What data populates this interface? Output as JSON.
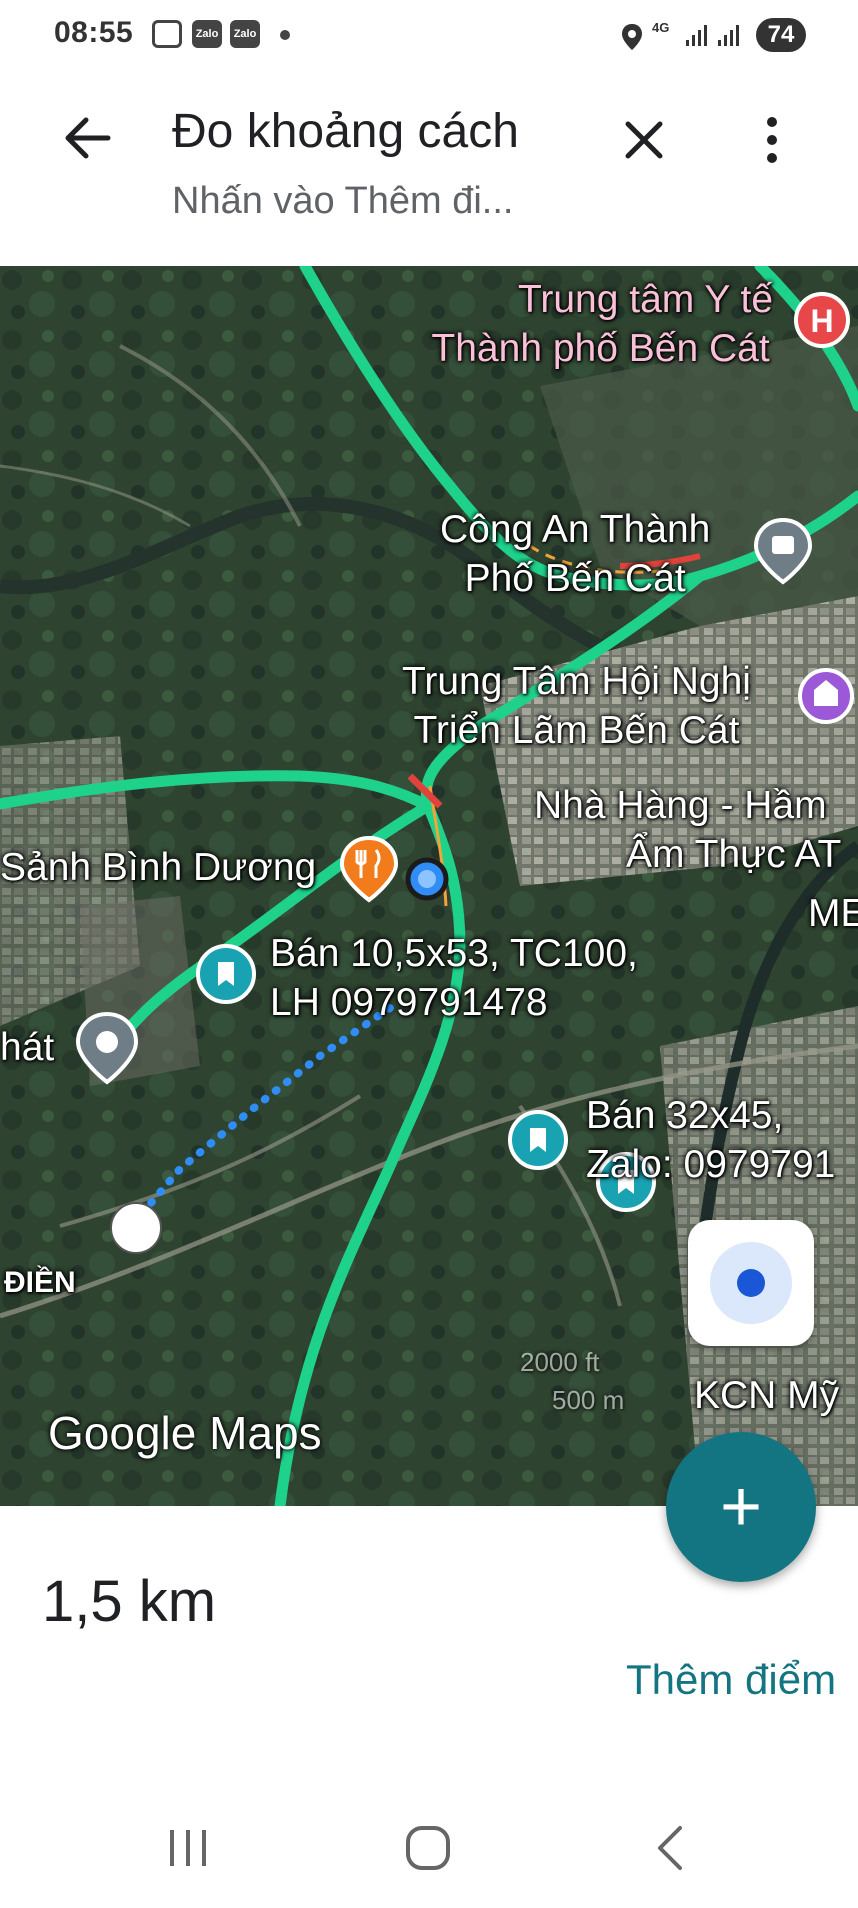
{
  "status_bar": {
    "time": "08:55",
    "icons": [
      "screenshot-icon",
      "zalo-icon",
      "zalo-icon",
      "notification-dot"
    ],
    "zalo_label": "Zalo",
    "network": "4G",
    "battery": "74"
  },
  "app_bar": {
    "title": "Đo khoảng cách",
    "subtitle": "Nhấn vào Thêm đi...",
    "icons": [
      "back-arrow-icon",
      "close-icon",
      "more-vert-icon"
    ]
  },
  "map": {
    "labels": {
      "hospital_line1": "Trung tâm Y tế",
      "hospital_line2": "Thành phố Bến Cát",
      "police_line1": "Công An Thành",
      "police_line2": "Phố Bến Cát",
      "convention_line1": "Trung Tâm Hội Nghị",
      "convention_line2": "Triển Lãm Bến Cát",
      "restaurant_line1": "Nhà Hàng - Hầm",
      "restaurant_line2": "Ẩm Thực AT",
      "me_partial": "ME",
      "sanh": "Sảnh Bình Dương",
      "listing1_line1": "Bán 10,5x53, TC100,",
      "listing1_line2": "LH 0979791478",
      "nhat_partial": "hát",
      "listing2_line1": "Bán 32x45,",
      "listing2_line2": "Zalo: 0979791",
      "dien_partial": "ĐIỀN",
      "kcn": "KCN Mỹ",
      "scale_ft": "2000 ft",
      "scale_m": "500 m"
    },
    "watermark": "Google Maps",
    "accent_road": "#1fd28c",
    "accent_route": "#2f8df5",
    "pin_teal": "#19a2b2",
    "pin_orange": "#f27b1b",
    "pin_red": "#e8474a",
    "pin_purple": "#9b59d8",
    "pin_gray": "#6f7d87"
  },
  "controls": {
    "my_location_icon": "my-location-icon",
    "fab_icon": "plus-icon",
    "fab_label": "+"
  },
  "sheet": {
    "distance": "1,5 km",
    "add_point": "Thêm điểm"
  },
  "nav_bar": {
    "icons": [
      "recents-icon",
      "home-icon",
      "back-icon"
    ]
  }
}
